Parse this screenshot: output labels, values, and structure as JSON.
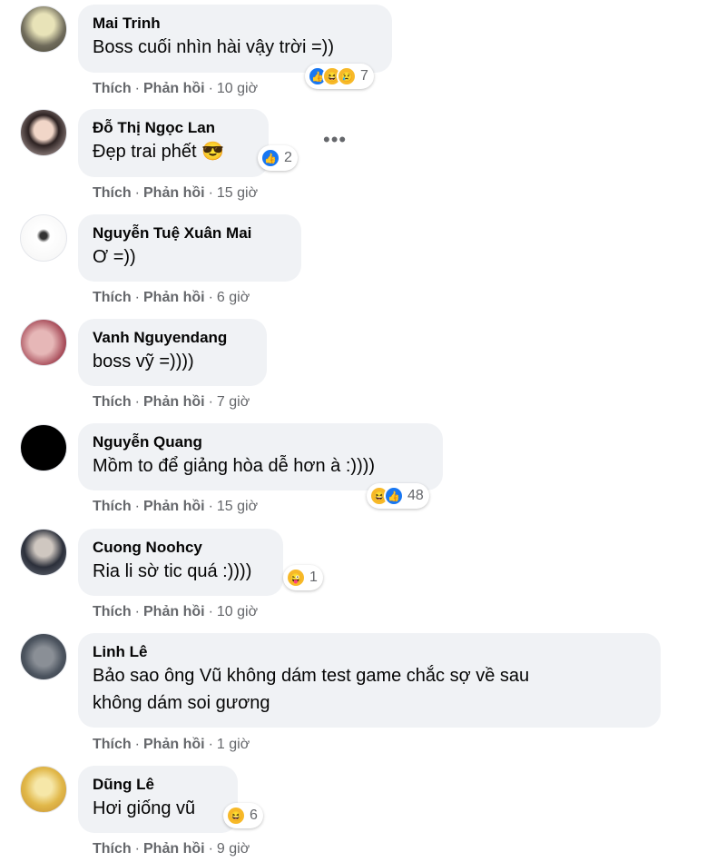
{
  "comments": [
    {
      "name": "Mai Trinh",
      "text": "Boss cuối nhìn hài vậy trời =))",
      "like": "Thích",
      "reply": "Phản hồi",
      "time": "10 giờ",
      "reactions": [
        "like-icon",
        "haha-icon",
        "sad-icon"
      ],
      "count": "7"
    },
    {
      "name": "Đỗ Thị Ngọc Lan",
      "text": "Đẹp trai phết 😎",
      "like": "Thích",
      "reply": "Phản hồi",
      "time": "15 giờ",
      "reactions": [
        "like-icon"
      ],
      "count": "2"
    },
    {
      "name": "Nguyễn Tuệ Xuân Mai",
      "text": "Ơ =))",
      "like": "Thích",
      "reply": "Phản hồi",
      "time": "6 giờ"
    },
    {
      "name": "Vanh Nguyendang",
      "text": "boss vỹ =))))",
      "like": "Thích",
      "reply": "Phản hồi",
      "time": "7 giờ"
    },
    {
      "name": "Nguyễn Quang",
      "text": "Mồm to để giảng hòa dễ hơn à :))))",
      "like": "Thích",
      "reply": "Phản hồi",
      "time": "15 giờ",
      "reactions": [
        "haha-icon",
        "like-icon"
      ],
      "count": "48"
    },
    {
      "name": "Cuong Noohcy",
      "text": "Ria li sờ tic quá :))))",
      "like": "Thích",
      "reply": "Phản hồi",
      "time": "10 giờ",
      "reactions": [
        "tongue-icon"
      ],
      "count": "1"
    },
    {
      "name": "Linh Lê",
      "text_line1": "Bảo sao ông Vũ không dám test game chắc sợ về sau",
      "text_line2": "không dám soi gương",
      "like": "Thích",
      "reply": "Phản hồi",
      "time": "1 giờ"
    },
    {
      "name": "Dũng Lê",
      "text": "Hơi giống vũ",
      "like": "Thích",
      "reply": "Phản hồi",
      "time": "9 giờ",
      "reactions": [
        "haha-icon"
      ],
      "count": "6"
    }
  ],
  "more_label": "•••",
  "colors": {
    "bubble": "#f0f2f5",
    "meta": "#65676b",
    "like_blue": "#1877f2",
    "haha_yellow": "#f7b928"
  }
}
